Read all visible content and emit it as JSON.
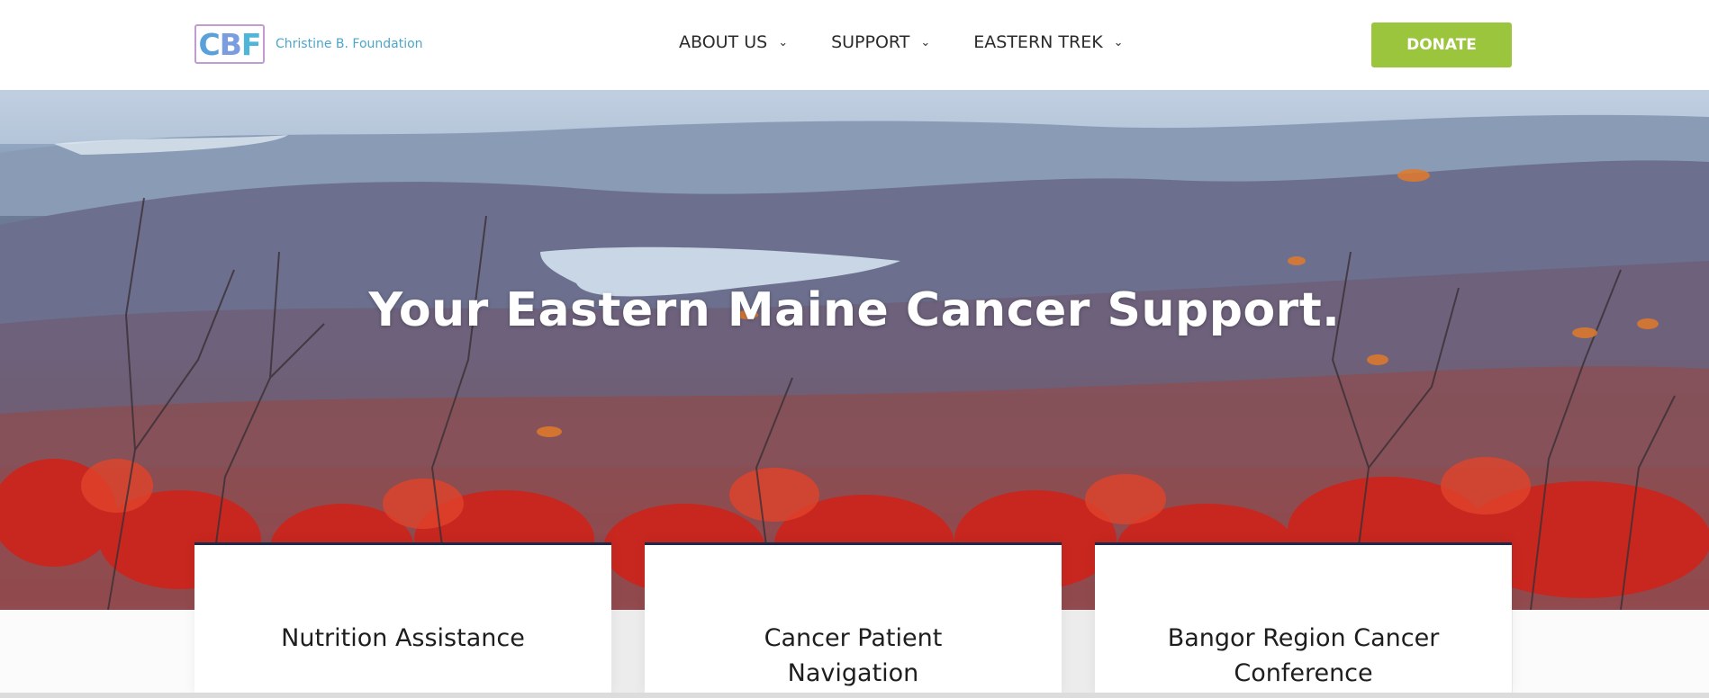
{
  "logo": {
    "mark_letters": [
      "C",
      "B",
      "F"
    ],
    "name": "Christine B. Foundation"
  },
  "nav": {
    "items": [
      {
        "label": "ABOUT US",
        "icon": "chevron-down-icon"
      },
      {
        "label": "SUPPORT",
        "icon": "chevron-down-icon"
      },
      {
        "label": "EASTERN TREK",
        "icon": "chevron-down-icon"
      }
    ],
    "chevron_glyph": "⌄"
  },
  "donate": {
    "label": "DONATE",
    "color": "#9ac53c"
  },
  "hero": {
    "title": "Your Eastern Maine Cancer Support."
  },
  "cards": [
    {
      "label": "Nutrition Assistance"
    },
    {
      "label": "Cancer Patient Navigation"
    },
    {
      "label": "Bangor Region Cancer Conference"
    }
  ],
  "colors": {
    "accent": "#9ac53c",
    "card_border": "#1d2a4a",
    "logo_blue": "#4da6c9"
  }
}
